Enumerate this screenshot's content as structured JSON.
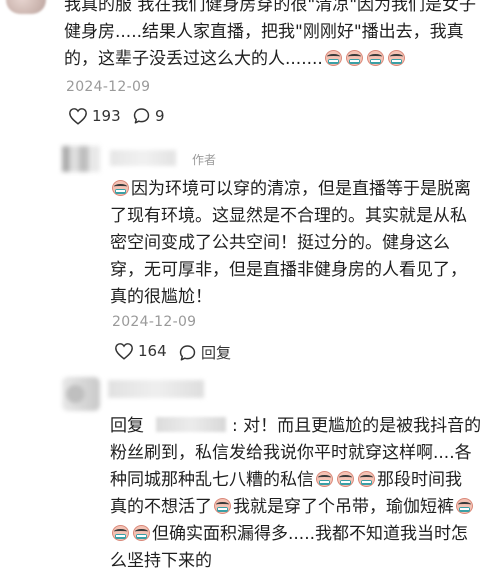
{
  "top_comment": {
    "lines": [
      "我真的服 我在我们健身房穿的很\"清凉\"因为我们是女子",
      "健身房.....结果人家直播，把我\"刚刚好\"播出去，我真",
      "的，这辈子没丢过这么大的人......."
    ],
    "emoji_count": 4,
    "emoji_name": "grimace-emoji",
    "date": "2024-12-09",
    "likes": "193",
    "comments": "9"
  },
  "reply_author": {
    "author_tag": "作者",
    "lines": [
      "因为环境可以穿的清凉，但是直播等于是脱离",
      "了现有环境。这显然是不合理的。其实就是从私",
      "密空间变成了公共空间！挺过分的。健身这么",
      "穿，无可厚非，但是直播非健身房的人看见了，",
      "真的很尴尬！"
    ],
    "date": "2024-12-09",
    "likes": "164",
    "reply_label": "回复"
  },
  "reply_second": {
    "reply_prefix": "回复",
    "after_mention": ": 对！而且更尴尬的是被我抖音的",
    "line2": "粉丝刷到，私信发给我说你平时就穿这样啊....各",
    "line3_a": "种同城那种乱七八糟的私信",
    "line3_b": "那段时间我",
    "line4_a": "真的不想活了",
    "line4_b": "我就是穿了个吊带，瑜伽短裤",
    "line5": "但确实面积漏得多.....我都不知道我当时怎",
    "line6": "么坚持下来的"
  },
  "colors": {
    "text": "#1f1f1f",
    "meta": "#9a9a9a",
    "background": "#ffffff"
  }
}
